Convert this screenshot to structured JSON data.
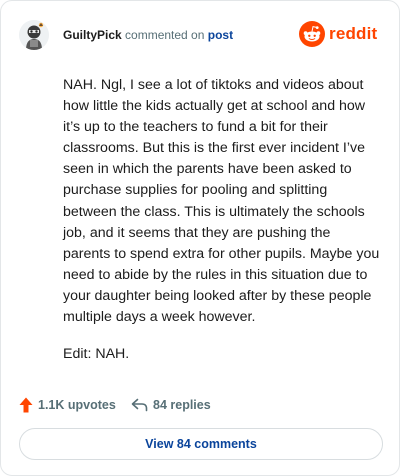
{
  "header": {
    "username": "GuiltyPick",
    "action_text": "commented on",
    "post_link": "post",
    "brand_name": "reddit"
  },
  "comment": {
    "paragraphs": [
      "NAH. Ngl, I see a lot of tiktoks and videos about how little the kids actually get at school and how it’s up to the teachers to fund a bit for their classrooms. But this is the first ever incident I’ve seen in which the parents have been asked to purchase supplies for pooling and splitting between the class. This is ultimately the schools job, and it seems that they are pushing the parents to spend extra for other pupils. Maybe you need to abide by the rules in this situation due to your daughter being looked after by these people multiple days a week however.",
      "Edit: NAH."
    ]
  },
  "stats": {
    "upvotes": "1.1K upvotes",
    "replies": "84 replies"
  },
  "view_button": "View 84 comments",
  "colors": {
    "brand": "#ff4500",
    "link": "#0a449b",
    "muted": "#576f76",
    "text": "#1c1c1c"
  },
  "icons": {
    "avatar": "avatar-icon",
    "brand": "reddit-snoo-icon",
    "upvote": "upvote-arrow-icon",
    "reply": "reply-arrow-icon"
  }
}
